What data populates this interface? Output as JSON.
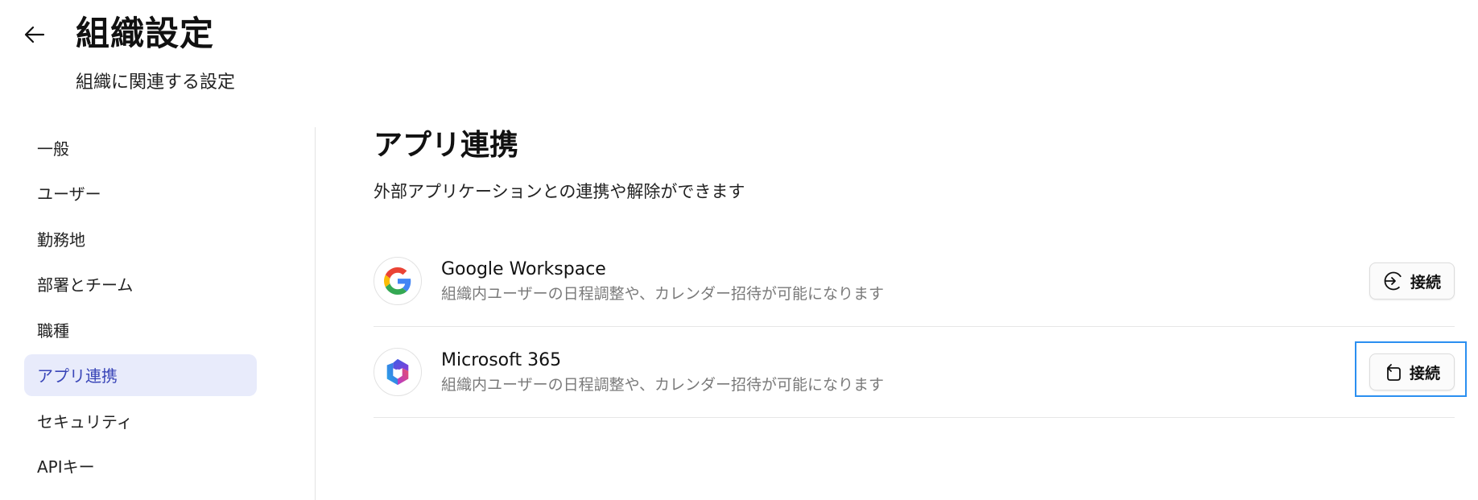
{
  "header": {
    "title": "組織設定",
    "subtitle": "組織に関連する設定",
    "back_icon": "arrow-left-icon"
  },
  "sidebar": {
    "items": [
      {
        "label": "一般",
        "active": false
      },
      {
        "label": "ユーザー",
        "active": false
      },
      {
        "label": "勤務地",
        "active": false
      },
      {
        "label": "部署とチーム",
        "active": false
      },
      {
        "label": "職種",
        "active": false
      },
      {
        "label": "アプリ連携",
        "active": true
      },
      {
        "label": "セキュリティ",
        "active": false
      },
      {
        "label": "APIキー",
        "active": false
      }
    ],
    "active_bg": "#e8ebfb",
    "active_text": "#3a46b8"
  },
  "main": {
    "title": "アプリ連携",
    "description": "外部アプリケーションとの連携や解除ができます",
    "apps": [
      {
        "name": "Google Workspace",
        "description": "組織内ユーザーの日程調整や、カレンダー招待が可能になります",
        "icon": "google-logo-icon",
        "button_label": "接続",
        "button_icon": "login-arrow-icon"
      },
      {
        "name": "Microsoft 365",
        "description": "組織内ユーザーの日程調整や、カレンダー招待が可能になります",
        "icon": "microsoft-365-logo-icon",
        "button_label": "接続",
        "button_icon": "rotate-arrow-icon"
      }
    ]
  },
  "colors": {
    "highlight": "#2b8ff0"
  }
}
